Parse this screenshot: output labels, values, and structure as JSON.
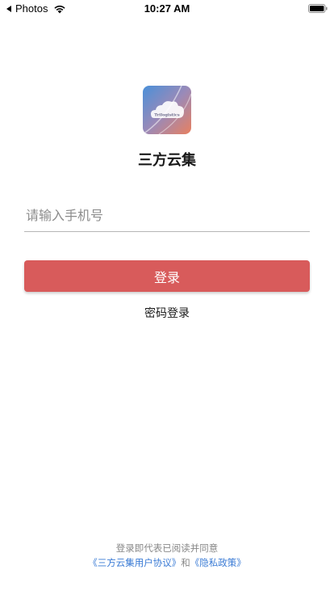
{
  "status_bar": {
    "back_app": "Photos",
    "time": "10:27 AM"
  },
  "logo": {
    "text": "Trilogistics",
    "icon": "cloud-logo-icon"
  },
  "app_name": "三方云集",
  "phone_field": {
    "placeholder": "请输入手机号",
    "value": ""
  },
  "login_button": {
    "label": "登录"
  },
  "password_login": {
    "label": "密码登录"
  },
  "agreement": {
    "prefix": "登录即代表已阅读并同意",
    "user_agreement": "《三方云集用户协议》",
    "conjunction": "和",
    "privacy_policy": "《隐私政策》"
  },
  "colors": {
    "primary_button": "#d85b5b",
    "link": "#3a7bd5",
    "logo_gradient_start": "#4a90d9",
    "logo_gradient_end": "#e88060"
  }
}
